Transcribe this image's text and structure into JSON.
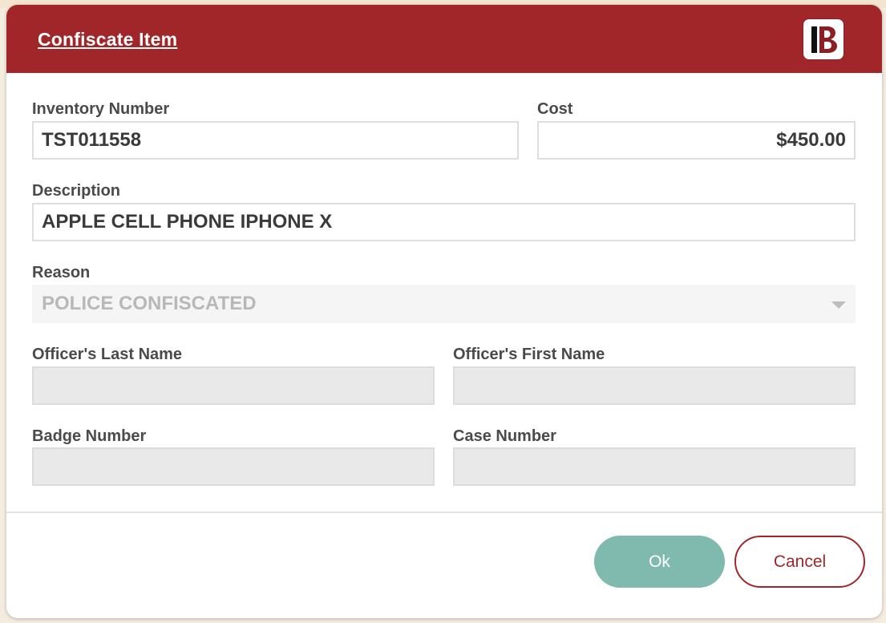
{
  "dialog": {
    "title": "Confiscate Item",
    "logo_icon": "brand-b-logo-icon"
  },
  "fields": {
    "inventory_number": {
      "label": "Inventory Number",
      "value": "TST011558"
    },
    "cost": {
      "label": "Cost",
      "value": "$450.00"
    },
    "description": {
      "label": "Description",
      "value": "APPLE CELL PHONE IPHONE X"
    },
    "reason": {
      "label": "Reason",
      "value": "POLICE CONFISCATED",
      "icon": "chevron-down-icon"
    },
    "officer_last_name": {
      "label": "Officer's Last Name",
      "value": ""
    },
    "officer_first_name": {
      "label": "Officer's First Name",
      "value": ""
    },
    "badge_number": {
      "label": "Badge Number",
      "value": ""
    },
    "case_number": {
      "label": "Case Number",
      "value": ""
    }
  },
  "buttons": {
    "ok_label": "Ok",
    "cancel_label": "Cancel"
  },
  "colors": {
    "header": "#a1262a",
    "ok_button": "#80b9ae",
    "cancel_border": "#a1262a"
  }
}
